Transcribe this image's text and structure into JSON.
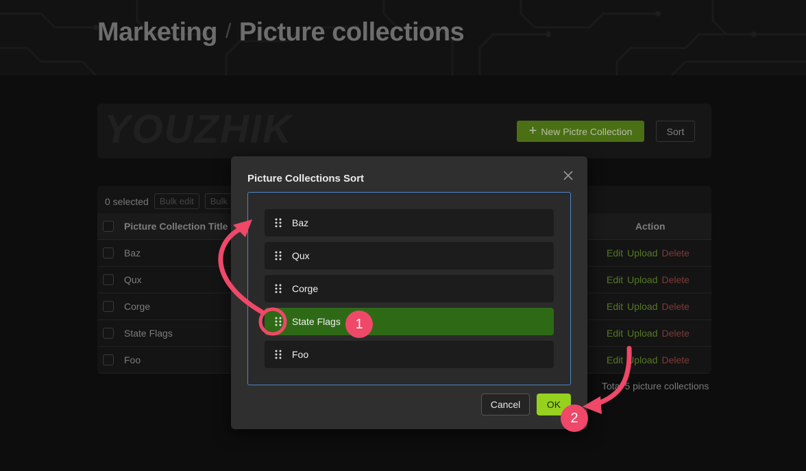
{
  "header": {
    "breadcrumb_parent": "Marketing",
    "separator": "/",
    "breadcrumb_current": "Picture collections"
  },
  "toolbar": {
    "logo_text": "YOUZHIK",
    "new_label": "New Pictre Collection",
    "sort_label": "Sort"
  },
  "table": {
    "selected_text": "0 selected",
    "bulk_edit_label": "Bulk edit",
    "bulk_other_label": "Bulk",
    "col_title": "Picture Collection Title",
    "col_action": "Action",
    "rows": [
      {
        "title": "Baz",
        "edit": "Edit",
        "upload": "Upload",
        "delete": "Delete"
      },
      {
        "title": "Qux",
        "edit": "Edit",
        "upload": "Upload",
        "delete": "Delete"
      },
      {
        "title": "Corge",
        "edit": "Edit",
        "upload": "Upload",
        "delete": "Delete"
      },
      {
        "title": "State Flags",
        "edit": "Edit",
        "upload": "Upload",
        "delete": "Delete"
      },
      {
        "title": "Foo",
        "edit": "Edit",
        "upload": "Upload",
        "delete": "Delete"
      }
    ],
    "total_text": "Total 5 picture collections"
  },
  "modal": {
    "title": "Picture Collections Sort",
    "close_icon": "close-icon",
    "items": [
      {
        "label": "Baz",
        "active": false
      },
      {
        "label": "Qux",
        "active": false
      },
      {
        "label": "Corge",
        "active": false
      },
      {
        "label": "State Flags",
        "active": true
      },
      {
        "label": "Foo",
        "active": false
      }
    ],
    "cancel_label": "Cancel",
    "ok_label": "OK"
  },
  "annotations": {
    "step1": "1",
    "step2": "2",
    "color": "#ef4868"
  },
  "colors": {
    "accent_green": "#95d11e",
    "active_row": "#2e6a16",
    "focus_border": "#4d86c7"
  }
}
